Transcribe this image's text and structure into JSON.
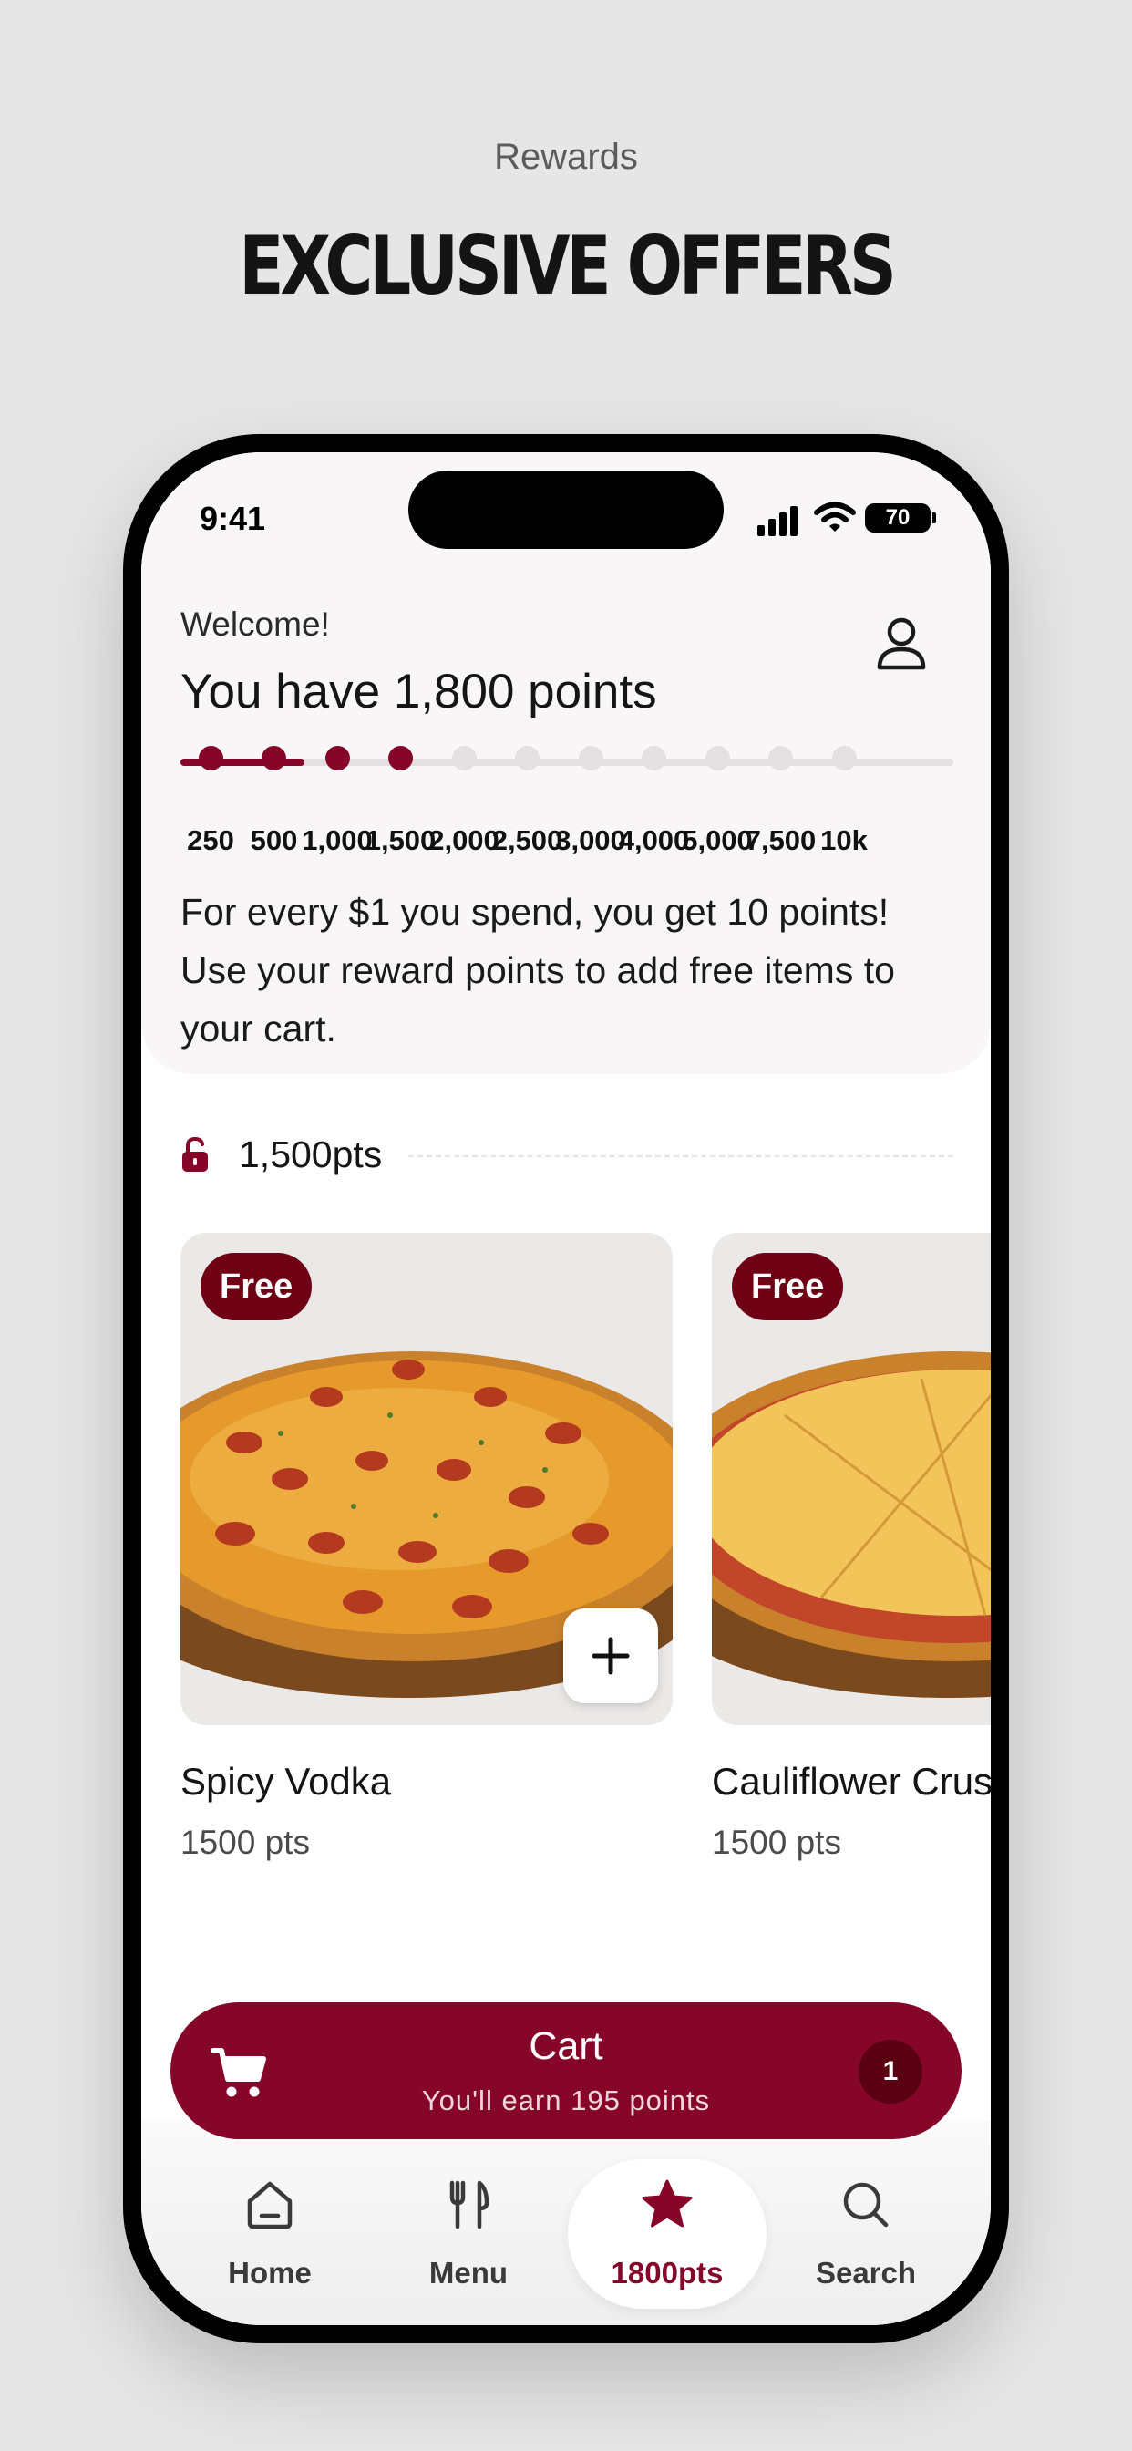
{
  "header": {
    "kicker": "Rewards",
    "title": "EXCLUSIVE OFFERS"
  },
  "status_bar": {
    "time": "9:41",
    "battery": "70"
  },
  "rewards": {
    "welcome": "Welcome!",
    "points_heading": "You have 1,800 points",
    "milestones": [
      "250",
      "500",
      "1,000",
      "1,500",
      "2,000",
      "2,500",
      "3,000",
      "4,000",
      "5,000",
      "7,500",
      "10k"
    ],
    "progress_fraction": 0.16,
    "info": "For every $1 you spend, you get 10 points! Use your reward points to add free items to your cart."
  },
  "tier": {
    "label": "1,500pts"
  },
  "items": [
    {
      "badge": "Free",
      "name": "Spicy Vodka",
      "points": "1500 pts"
    },
    {
      "badge": "Free",
      "name": "Cauliflower Crust",
      "points": "1500 pts"
    }
  ],
  "cart": {
    "title": "Cart",
    "subtitle": "You'll earn 195 points",
    "count": "1"
  },
  "tabs": [
    {
      "label": "Home",
      "icon": "home-icon"
    },
    {
      "label": "Menu",
      "icon": "fork-knife-icon"
    },
    {
      "label": "1800pts",
      "icon": "star-icon"
    },
    {
      "label": "Search",
      "icon": "search-icon"
    }
  ],
  "colors": {
    "brand": "#86062a",
    "badge": "#6e0214",
    "background": "#e6e6e6"
  }
}
